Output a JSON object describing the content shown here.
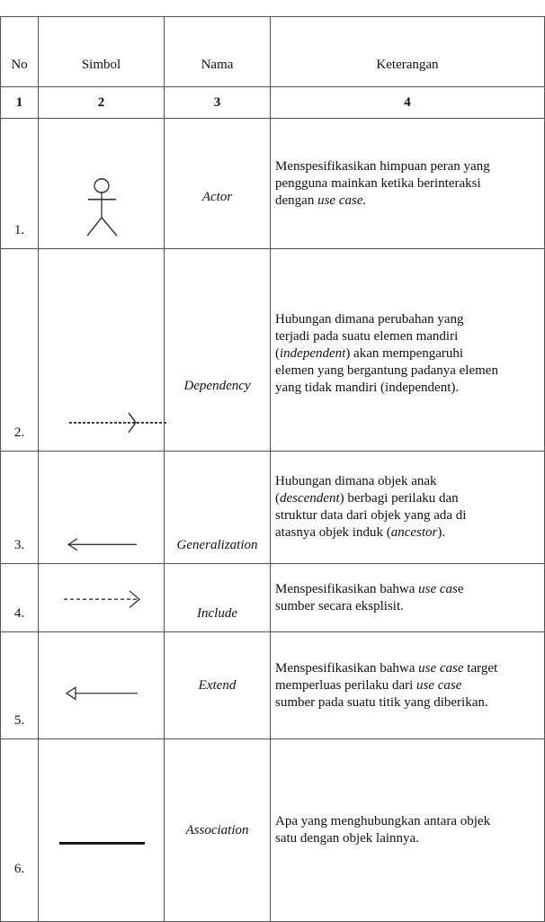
{
  "table": {
    "headers": {
      "no": "No",
      "symbol": "Simbol",
      "name": "Nama",
      "description": "Keterangan"
    },
    "column_numbers": [
      "1",
      "2",
      "3",
      "4"
    ],
    "rows": [
      {
        "no": "1.",
        "symbol_icon": "actor-icon",
        "name": "Actor",
        "description": {
          "l1": "Menspesifikasikan himpuan peran yang",
          "l2": "pengguna mainkan ketika berinteraksi",
          "l3a": "dengan ",
          "l3b": "use case."
        }
      },
      {
        "no": "2.",
        "symbol_icon": "dependency-arrow-icon",
        "name": "Dependency",
        "description": {
          "l1": "Hubungan dimana perubahan yang",
          "l2": "terjadi pada suatu elemen mandiri",
          "l3a": "(",
          "l3b": "independent",
          "l3c": ") akan mempengaruhi",
          "l4": "elemen yang bergantung padanya elemen",
          "l5": "yang tidak mandiri (independent)."
        }
      },
      {
        "no": "3.",
        "symbol_icon": "generalization-arrow-icon",
        "name": "Generalization",
        "description": {
          "l1": "Hubungan dimana objek anak",
          "l2a": "(",
          "l2b": "descendent",
          "l2c": ") berbagi perilaku dan",
          "l3": "struktur data dari objek yang ada di",
          "l4a": "atasnya objek induk (",
          "l4b": "ancestor",
          "l4c": ")."
        }
      },
      {
        "no": "4.",
        "symbol_icon": "include-arrow-icon",
        "name": "Include",
        "description": {
          "l1a": "Menspesifikasikan bahwa ",
          "l1b": "use cas",
          "l1c": "e",
          "l2": "sumber secara eksplisit."
        }
      },
      {
        "no": "5.",
        "symbol_icon": "extend-arrow-icon",
        "name": "Extend",
        "description": {
          "l1a": "Menspesifikasikan bahwa ",
          "l1b": "use case",
          "l1c": " target",
          "l2a": "memperluas perilaku dari ",
          "l2b": "use case",
          "l3": "sumber pada suatu titik yang diberikan."
        }
      },
      {
        "no": "6.",
        "symbol_icon": "association-line-icon",
        "name": "Association",
        "description": {
          "l1": "Apa yang menghubungkan antara objek",
          "l2": "satu dengan objek lainnya."
        }
      }
    ]
  }
}
